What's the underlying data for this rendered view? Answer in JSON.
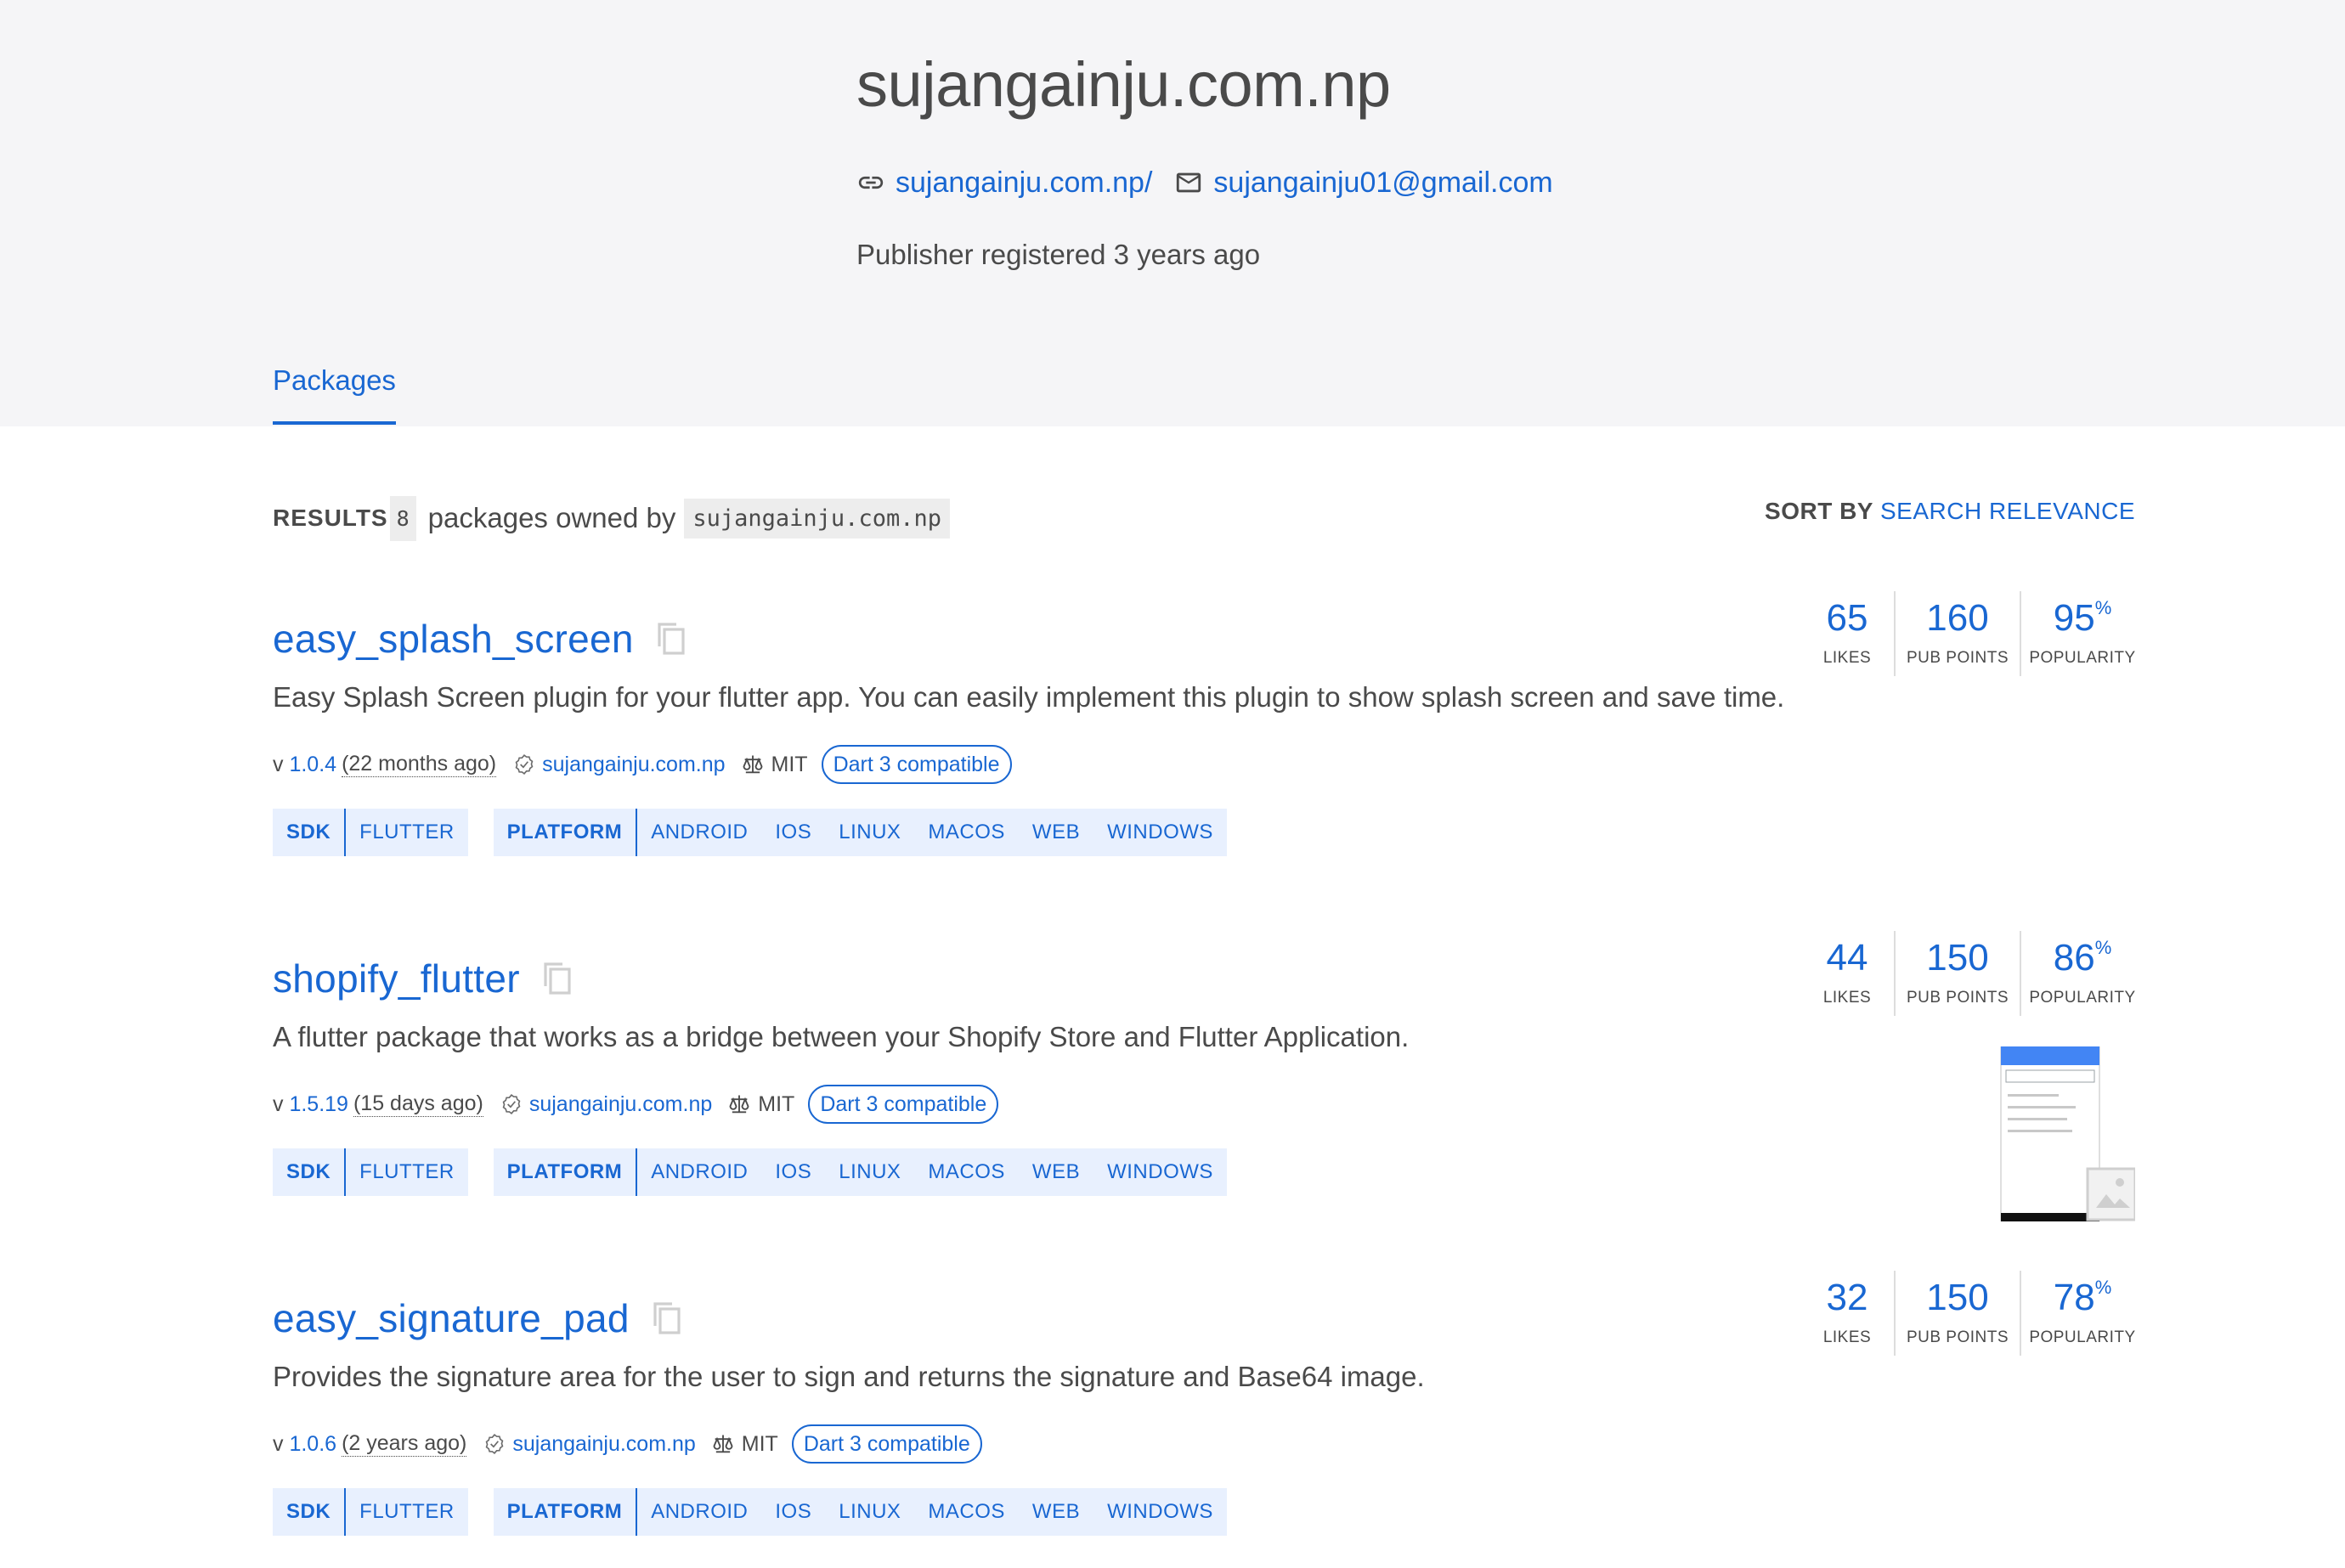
{
  "publisher": {
    "title": "sujangainju.com.np",
    "website_link": "sujangainju.com.np/",
    "email_link": "sujangainju01@gmail.com",
    "registered": "Publisher registered 3 years ago"
  },
  "tabs": {
    "packages": "Packages"
  },
  "results": {
    "label": "RESULTS",
    "count": "8",
    "text": "packages owned by",
    "publisher": "sujangainju.com.np",
    "sort_label": "SORT BY",
    "sort_value": "SEARCH RELEVANCE"
  },
  "packages": [
    {
      "name": "easy_splash_screen",
      "description": "Easy Splash Screen plugin for your flutter app. You can easily implement this plugin to show splash screen and save time.",
      "version_prefix": "v",
      "version": "1.0.4",
      "ago": "(22 months ago)",
      "publisher": "sujangainju.com.np",
      "license": "MIT",
      "dart3": "Dart 3 compatible",
      "sdk_label": "SDK",
      "sdk": [
        "FLUTTER"
      ],
      "platform_label": "PLATFORM",
      "platforms": [
        "ANDROID",
        "IOS",
        "LINUX",
        "MACOS",
        "WEB",
        "WINDOWS"
      ],
      "likes": "65",
      "likes_label": "LIKES",
      "points": "160",
      "points_label": "PUB POINTS",
      "popularity": "95",
      "popularity_unit": "%",
      "popularity_label": "POPULARITY"
    },
    {
      "name": "shopify_flutter",
      "description": "A flutter package that works as a bridge between your Shopify Store and Flutter Application.",
      "version_prefix": "v",
      "version": "1.5.19",
      "ago": "(15 days ago)",
      "publisher": "sujangainju.com.np",
      "license": "MIT",
      "dart3": "Dart 3 compatible",
      "sdk_label": "SDK",
      "sdk": [
        "FLUTTER"
      ],
      "platform_label": "PLATFORM",
      "platforms": [
        "ANDROID",
        "IOS",
        "LINUX",
        "MACOS",
        "WEB",
        "WINDOWS"
      ],
      "likes": "44",
      "likes_label": "LIKES",
      "points": "150",
      "points_label": "PUB POINTS",
      "popularity": "86",
      "popularity_unit": "%",
      "popularity_label": "POPULARITY"
    },
    {
      "name": "easy_signature_pad",
      "description": "Provides the signature area for the user to sign and returns the signature and Base64 image.",
      "version_prefix": "v",
      "version": "1.0.6",
      "ago": "(2 years ago)",
      "publisher": "sujangainju.com.np",
      "license": "MIT",
      "dart3": "Dart 3 compatible",
      "sdk_label": "SDK",
      "sdk": [
        "FLUTTER"
      ],
      "platform_label": "PLATFORM",
      "platforms": [
        "ANDROID",
        "IOS",
        "LINUX",
        "MACOS",
        "WEB",
        "WINDOWS"
      ],
      "likes": "32",
      "likes_label": "LIKES",
      "points": "150",
      "points_label": "PUB POINTS",
      "popularity": "78",
      "popularity_unit": "%",
      "popularity_label": "POPULARITY"
    }
  ],
  "colors": {
    "link": "#1967d2",
    "header_bg": "#f5f5f7",
    "tag_bg": "#e8f0fe",
    "text": "#4a4a4a"
  }
}
